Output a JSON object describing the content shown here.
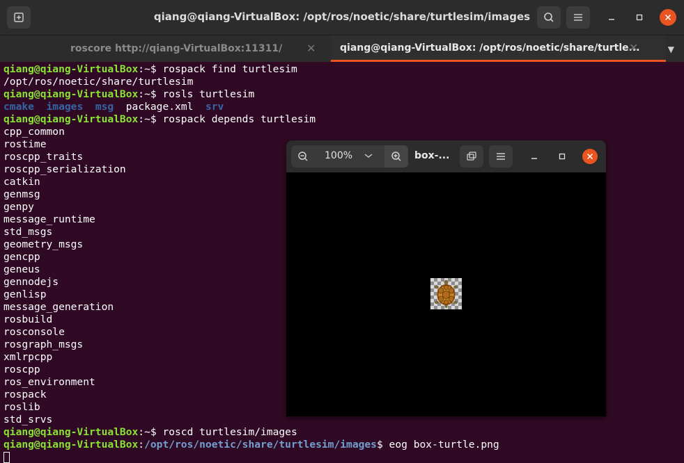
{
  "window": {
    "title": "qiang@qiang-VirtualBox: /opt/ros/noetic/share/turtlesim/images",
    "accent_color": "#e95420",
    "controls": [
      "minimize-icon",
      "maximize-icon",
      "close-icon"
    ]
  },
  "tabs": [
    {
      "label": "roscore http://qiang-VirtualBox:11311/",
      "active": false
    },
    {
      "label": "qiang@qiang-VirtualBox: /opt/ros/noetic/share/turtle...",
      "active": true
    }
  ],
  "terminal": {
    "prompt_user": "qiang@qiang-VirtualBox",
    "prompt_home": ":~$",
    "commands": {
      "c1": " rospack find turtlesim",
      "c2": " rosls turtlesim",
      "c3": " rospack depends turtlesim",
      "c4": " roscd turtlesim/images",
      "c5": " eog box-turtle.png"
    },
    "output_find": "/opt/ros/noetic/share/turtlesim",
    "ls_items": [
      "cmake",
      "images",
      "msg",
      "package.xml",
      "srv"
    ],
    "depends": [
      "cpp_common",
      "rostime",
      "roscpp_traits",
      "roscpp_serialization",
      "catkin",
      "genmsg",
      "genpy",
      "message_runtime",
      "std_msgs",
      "geometry_msgs",
      "gencpp",
      "geneus",
      "gennodejs",
      "genlisp",
      "message_generation",
      "rosbuild",
      "rosconsole",
      "rosgraph_msgs",
      "xmlrpcpp",
      "roscpp",
      "ros_environment",
      "rospack",
      "roslib",
      "std_srvs"
    ],
    "last_prompt_path_prefix": ":",
    "last_prompt_path": "/opt/ros/noetic/share/turtlesim/images",
    "last_prompt_suffix": "$"
  },
  "viewer": {
    "zoom": "100%",
    "title": "box-...",
    "image_name": "box-turtle.png"
  }
}
